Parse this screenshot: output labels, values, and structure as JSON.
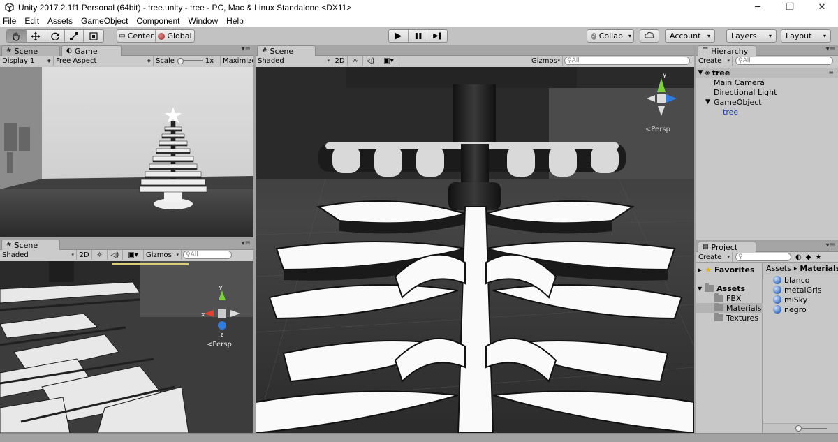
{
  "window": {
    "title": "Unity 2017.2.1f1 Personal (64bit) - tree.unity - tree - PC, Mac & Linux Standalone <DX11>",
    "controls": [
      "─",
      "❐",
      "✕"
    ]
  },
  "menu": [
    "File",
    "Edit",
    "Assets",
    "GameObject",
    "Component",
    "Window",
    "Help"
  ],
  "toolbar": {
    "tools": [
      "hand-tool",
      "move-tool",
      "rotate-tool",
      "scale-tool",
      "rect-tool"
    ],
    "pivot_label": "Center",
    "space_label": "Global",
    "play": "▶",
    "pause": "❚❚",
    "step": "▶❚",
    "collab_label": "Collab",
    "account_label": "Account",
    "layers_label": "Layers",
    "layout_label": "Layout"
  },
  "game_panel": {
    "tabs": [
      "Scene",
      "Game"
    ],
    "display": "Display 1",
    "aspect": "Free Aspect",
    "scale_label": "Scale",
    "scale_value": "1x",
    "maximize_label": "Maximize"
  },
  "scene_small": {
    "tab": "Scene",
    "shading": "Shaded",
    "mode_2d": "2D",
    "gizmos": "Gizmos",
    "search_placeholder": "All",
    "persp_label": "<Persp",
    "axis_x": "x",
    "axis_y": "y",
    "axis_z": "z"
  },
  "scene_main": {
    "tab": "Scene",
    "shading": "Shaded",
    "mode_2d": "2D",
    "gizmos": "Gizmos",
    "search_placeholder": "All",
    "persp_label": "<Persp",
    "axis_y": "y"
  },
  "hierarchy": {
    "tab": "Hierarchy",
    "create_label": "Create",
    "search_placeholder": "All",
    "scene_name": "tree",
    "items": [
      "Main Camera",
      "Directional Light",
      "GameObject",
      "tree"
    ]
  },
  "project": {
    "tab": "Project",
    "create_label": "Create",
    "favorites_label": "Favorites",
    "assets_label": "Assets",
    "folders": [
      "FBX",
      "Materials",
      "Textures"
    ],
    "breadcrumb_root": "Assets",
    "breadcrumb_sep": "▸",
    "breadcrumb_current": "Materials",
    "materials": [
      "blanco",
      "metalGris",
      "miSky",
      "negro"
    ]
  },
  "colors": {
    "selection": "#8fa9d4",
    "prefab_text": "#1b3aa6",
    "panel_bg": "#c8c8c8"
  }
}
